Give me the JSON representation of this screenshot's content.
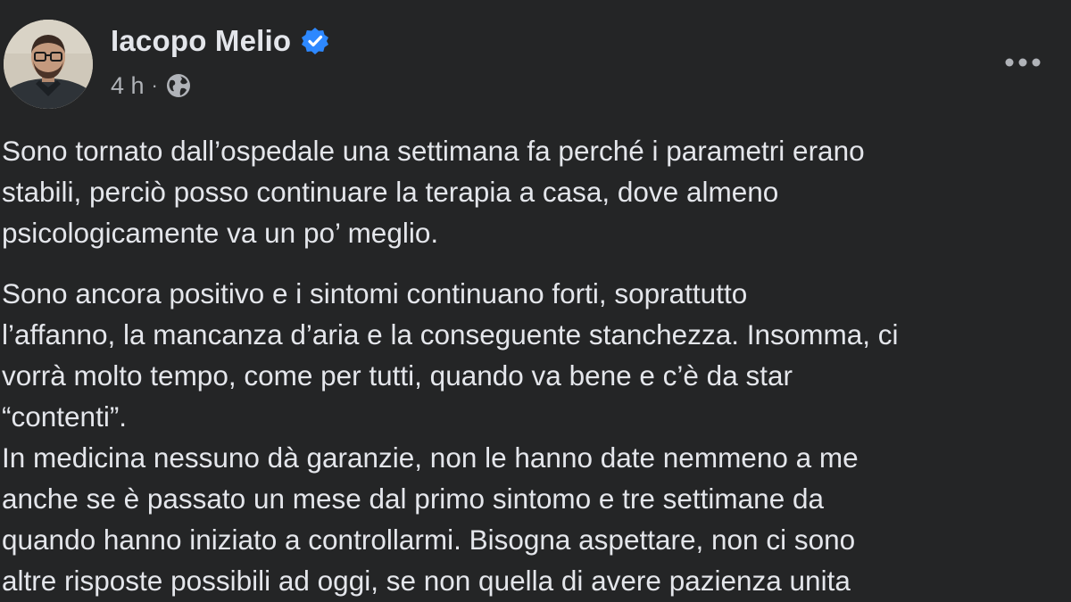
{
  "post": {
    "author": {
      "name": "Iacopo Melio",
      "verified_icon": "verified-badge-icon",
      "avatar_icon": "profile-photo"
    },
    "meta": {
      "timestamp": "4 h",
      "separator": "·",
      "audience_icon": "globe-icon"
    },
    "more_icon": "more-options-icon",
    "paragraphs": [
      {
        "lines": [
          "Sono tornato dall’ospedale una settimana fa perché i parametri erano",
          "stabili, perciò posso continuare la terapia a casa, dove almeno",
          "psicologicamente va un po’ meglio."
        ]
      },
      {
        "lines": [
          "Sono ancora positivo e i sintomi continuano forti, soprattutto",
          "l’affanno, la mancanza d’aria e la conseguente stanchezza. Insomma, ci",
          "vorrà molto tempo, come per tutti, quando va bene e c’è da star",
          "“contenti”."
        ]
      },
      {
        "lines": [
          "In medicina nessuno dà garanzie, non le hanno date nemmeno a me",
          "anche se è passato un mese dal primo sintomo e tre settimane da",
          "quando hanno iniziato a controllarmi. Bisogna aspettare, non ci sono",
          "altre risposte possibili ad oggi, se non quella di avere pazienza unita"
        ]
      }
    ]
  },
  "colors": {
    "background": "#242526",
    "primary_text": "#e4e6eb",
    "secondary_text": "#b0b3b8",
    "verified_blue": "#2d88ff"
  }
}
